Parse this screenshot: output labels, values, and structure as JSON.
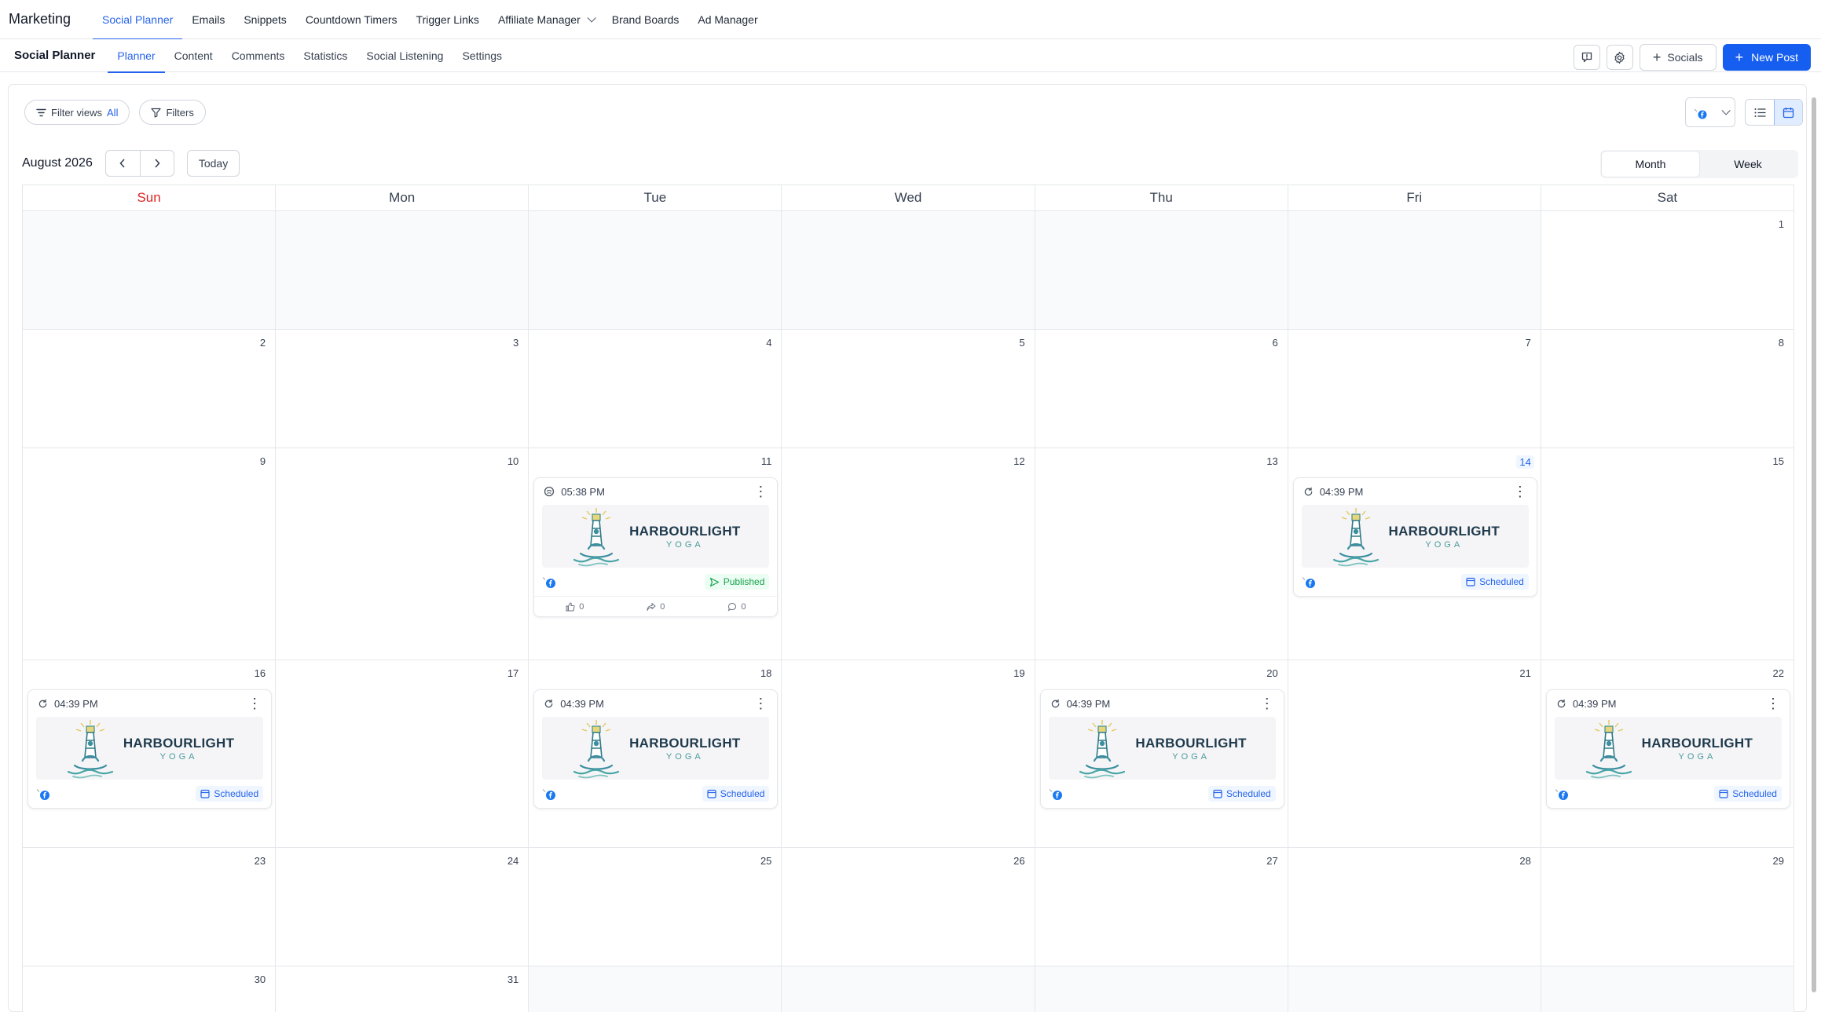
{
  "topnav": {
    "app_title": "Marketing",
    "items": [
      {
        "label": "Social Planner",
        "active": true
      },
      {
        "label": "Emails"
      },
      {
        "label": "Snippets"
      },
      {
        "label": "Countdown Timers"
      },
      {
        "label": "Trigger Links"
      },
      {
        "label": "Affiliate Manager",
        "dropdown": true
      },
      {
        "label": "Brand Boards"
      },
      {
        "label": "Ad Manager"
      }
    ]
  },
  "subnav": {
    "title": "Social Planner",
    "tabs": [
      {
        "label": "Planner",
        "active": true
      },
      {
        "label": "Content"
      },
      {
        "label": "Comments"
      },
      {
        "label": "Statistics"
      },
      {
        "label": "Social Listening"
      },
      {
        "label": "Settings"
      }
    ],
    "socials_label": "Socials",
    "new_post_label": "New Post"
  },
  "toolbar": {
    "filter_views_label": "Filter views",
    "filter_views_value": "All",
    "filters_label": "Filters"
  },
  "calendar": {
    "month_label": "August 2026",
    "today_label": "Today",
    "view_month": "Month",
    "view_week": "Week",
    "weekdays": [
      "Sun",
      "Mon",
      "Tue",
      "Wed",
      "Thu",
      "Fri",
      "Sat"
    ],
    "weeks": [
      [
        null,
        null,
        null,
        null,
        null,
        null,
        1
      ],
      [
        2,
        3,
        4,
        5,
        6,
        7,
        8
      ],
      [
        9,
        10,
        11,
        12,
        13,
        14,
        15
      ],
      [
        16,
        17,
        18,
        19,
        20,
        21,
        22
      ],
      [
        23,
        24,
        25,
        26,
        27,
        28,
        29
      ],
      [
        30,
        31,
        null,
        null,
        null,
        null,
        null
      ]
    ],
    "today": 14,
    "posts": [
      {
        "day": 11,
        "time": "05:38 PM",
        "status": "Published",
        "likes": "0",
        "shares": "0",
        "comments": "0"
      },
      {
        "day": 14,
        "time": "04:39 PM",
        "status": "Scheduled"
      },
      {
        "day": 16,
        "time": "04:39 PM",
        "status": "Scheduled"
      },
      {
        "day": 18,
        "time": "04:39 PM",
        "status": "Scheduled"
      },
      {
        "day": 20,
        "time": "04:39 PM",
        "status": "Scheduled"
      },
      {
        "day": 22,
        "time": "04:39 PM",
        "status": "Scheduled"
      }
    ],
    "post_image": {
      "name": "HARBOURLIGHT",
      "sub": "YOGA"
    }
  },
  "colors": {
    "accent": "#155eef",
    "sunday": "#dc2626",
    "published": "#16a34a",
    "scheduled": "#2563eb",
    "facebook": "#1877f2"
  }
}
